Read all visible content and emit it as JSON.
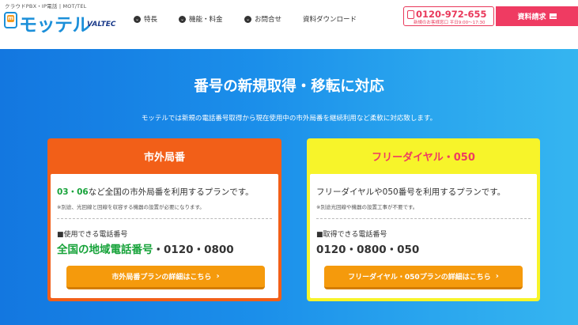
{
  "header": {
    "tagline": "クラウドPBX・IP電話 | MOT/TEL",
    "logo_icon": "m",
    "logo_text": "モッテル",
    "logo_sub": "VALTEC",
    "nav": [
      {
        "label": "特長",
        "icon": "chevron-circle-down-icon"
      },
      {
        "label": "機能・料金",
        "icon": "chevron-circle-down-icon"
      },
      {
        "label": "お問合せ",
        "icon": "chevron-circle-down-icon"
      },
      {
        "label": "資料ダウンロード"
      }
    ],
    "tel_number": "0120-972-655",
    "tel_hours": "新規のお客様窓口 平日9:00～17:30",
    "doc_button": "資料請求"
  },
  "hero": {
    "title": "番号の新規取得・移転に対応",
    "subtitle": "モッテルでは新規の電話番号取得から現在使用中の市外局番を継続利用など柔軟に対応致します。"
  },
  "cards": [
    {
      "title": "市外局番",
      "desc_highlight": "03・06",
      "desc": "など全国の市外局番を利用するプランです。",
      "note": "※別途、光回線と回線を収容する機器の設置が必要になります。",
      "label": "■使用できる電話番号",
      "numbers_highlight": "全国の地域電話番号",
      "numbers": "・0120・0800",
      "button": "市外局番プランの詳細はこちら"
    },
    {
      "title": "フリーダイヤル・050",
      "desc": "フリーダイヤルや050番号を利用するプランです。",
      "note": "※別途光回線や機器の設置工事が不要です。",
      "label": "■取得できる電話番号",
      "numbers": "0120・0800・050",
      "button": "フリーダイヤル・050プランの詳細はこちら"
    }
  ],
  "colors": {
    "brand_blue": "#1b8fd9",
    "accent_pink": "#ef3b62",
    "card_orange": "#f25f18",
    "card_yellow": "#f7f42a",
    "button_orange": "#f59a0c",
    "highlight_green": "#17a33a"
  }
}
